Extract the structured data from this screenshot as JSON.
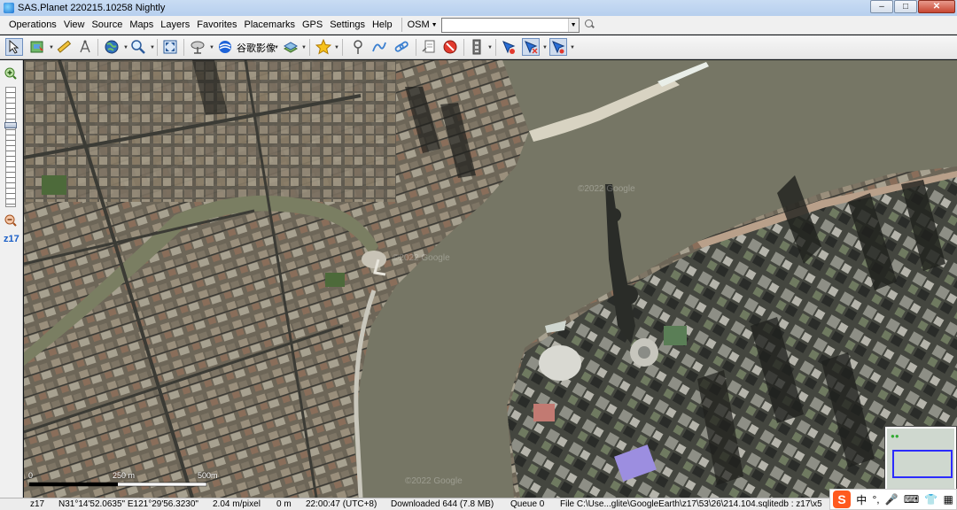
{
  "window": {
    "title": "SAS.Planet 220215.10258 Nightly",
    "buttons": {
      "minimize": "–",
      "maximize": "□",
      "close": "✕"
    }
  },
  "menu": {
    "items": [
      "Operations",
      "View",
      "Source",
      "Maps",
      "Layers",
      "Favorites",
      "Placemarks",
      "GPS",
      "Settings",
      "Help"
    ],
    "map_selector": "OSM",
    "search": {
      "value": "",
      "placeholder": ""
    }
  },
  "toolbar": {
    "map_type_label": "谷歌影像",
    "icons": [
      "cursor-icon",
      "map-layers-icon",
      "ruler-icon",
      "compass-icon",
      "globe-icon",
      "magnifier-icon",
      "fullscreen-icon",
      "satellite-dish-icon",
      "google-earth-icon",
      "layers-stack-icon",
      "star-icon",
      "pin-icon",
      "path-icon",
      "link-icon",
      "note-icon",
      "delete-circle-icon",
      "film-strip-icon",
      "gps-arrow-icon",
      "gps-arrow-pressed-icon",
      "gps-arrow-active-icon"
    ]
  },
  "zoom": {
    "level": "z17"
  },
  "map": {
    "watermarks": [
      "©2022 Google",
      "©2022 Google",
      "©2022 Google"
    ],
    "scale": {
      "start": "0",
      "mid": "250 m",
      "end": "500m"
    }
  },
  "status": {
    "zoom": "z17",
    "coords": "N31°14'52.0635\" E121°29'56.3230\"",
    "resolution": "2.04 m/pixel",
    "elevation": "0 m",
    "time": "22:00:47 (UTC+8)",
    "downloaded": "Downloaded 644 (7.8 MB)",
    "queue": "Queue 0",
    "file": "File C:\\Use...glite\\GoogleEarth\\z17\\53\\26\\214.104.sqlitedb : z17\\x5"
  },
  "ime": {
    "logo": "S",
    "lang": "中",
    "items": [
      "°,",
      "🎤",
      "⌨",
      "👕",
      "▦"
    ]
  }
}
